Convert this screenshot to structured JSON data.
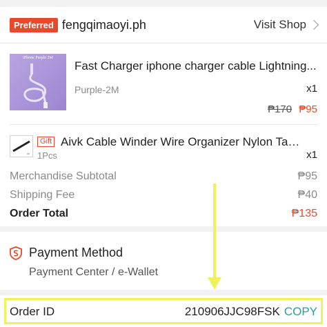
{
  "shop": {
    "badge": "Preferred",
    "name": "fengqimaoyi.ph",
    "visit_label": "Visit Shop"
  },
  "items": [
    {
      "thumb_caption": "iPhone Purple 2M",
      "title": "Fast Charger iphone charger cable Lightning...",
      "variant": "Purple-2M",
      "qty": "x1",
      "old_price": "₱170",
      "price": "₱95"
    }
  ],
  "gift": {
    "tag": "Gift",
    "title": "Aivk Cable Winder Wire Organizer Nylon Tape fo...",
    "pcs": "1Pcs",
    "qty": "x1"
  },
  "summary": {
    "subtotal_label": "Merchandise Subtotal",
    "subtotal_value": "₱95",
    "shipping_label": "Shipping Fee",
    "shipping_value": "₱40",
    "total_label": "Order Total",
    "total_value": "₱135"
  },
  "payment": {
    "title": "Payment Method",
    "method": "Payment Center / e-Wallet",
    "icon": "shield-s-icon"
  },
  "order": {
    "id_label": "Order ID",
    "id_value": "210906JJC98FSK",
    "copy_label": "COPY"
  },
  "colors": {
    "accent": "#e8492b",
    "copy": "#2aa198",
    "highlight": "#eef25c"
  }
}
